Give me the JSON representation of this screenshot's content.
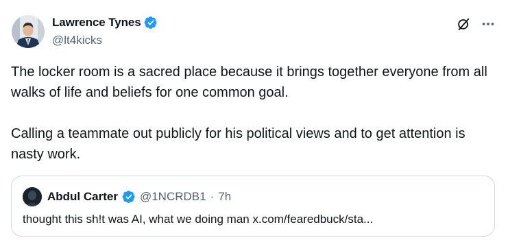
{
  "tweet": {
    "author": {
      "name": "Lawrence Tynes",
      "handle": "@lt4kicks",
      "verified": true,
      "avatar": "profile-photo"
    },
    "actions": {
      "grok_icon": "grok-icon",
      "more_icon": "more-icon"
    },
    "paragraphs": [
      "The locker room is a sacred place because it brings together everyone from all walks of life and beliefs for one common goal.",
      "Calling a teammate out publicly for his political views and to get attention is nasty work."
    ],
    "quote": {
      "name": "Abdul Carter",
      "handle": "@1NCRDB1",
      "separator": "·",
      "time": "7h",
      "verified": true,
      "text": "thought this sh!t was AI, what we doing man x.com/fearedbuck/sta..."
    }
  },
  "colors": {
    "verified": "#1d9bf0",
    "secondary_text": "#536471",
    "border": "#cfd9de",
    "primary_text": "#0f1419"
  }
}
